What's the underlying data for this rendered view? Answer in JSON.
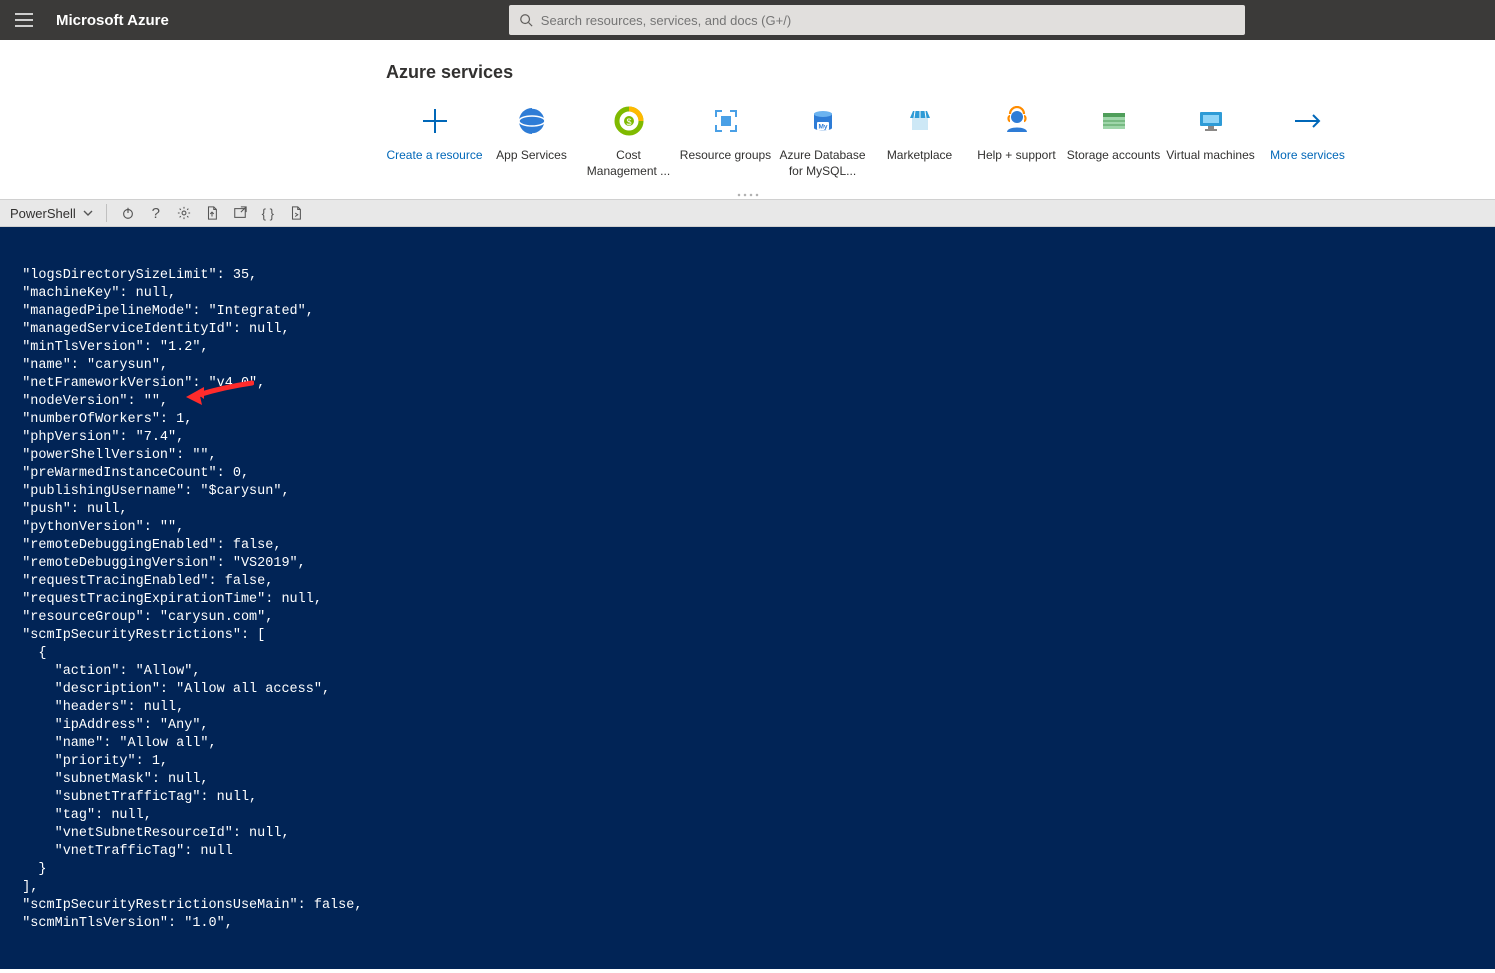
{
  "header": {
    "brand": "Microsoft Azure",
    "search_placeholder": "Search resources, services, and docs (G+/)"
  },
  "services": {
    "title": "Azure services",
    "items": [
      {
        "label": "Create a resource",
        "link": true,
        "icon": "plus"
      },
      {
        "label": "App Services",
        "link": false,
        "icon": "appservices"
      },
      {
        "label": "Cost Management ...",
        "link": false,
        "icon": "cost"
      },
      {
        "label": "Resource groups",
        "link": false,
        "icon": "resourcegroups"
      },
      {
        "label": "Azure Database for MySQL...",
        "link": false,
        "icon": "mysql"
      },
      {
        "label": "Marketplace",
        "link": false,
        "icon": "marketplace"
      },
      {
        "label": "Help + support",
        "link": false,
        "icon": "support"
      },
      {
        "label": "Storage accounts",
        "link": false,
        "icon": "storage"
      },
      {
        "label": "Virtual machines",
        "link": false,
        "icon": "vm"
      },
      {
        "label": "More services",
        "link": true,
        "icon": "arrow"
      }
    ]
  },
  "shell": {
    "mode": "PowerShell"
  },
  "terminal": {
    "json": {
      "logsDirectorySizeLimit": 35,
      "machineKey": null,
      "managedPipelineMode": "Integrated",
      "managedServiceIdentityId": null,
      "minTlsVersion": "1.2",
      "name": "carysun",
      "netFrameworkVersion": "v4.0",
      "nodeVersion": "",
      "numberOfWorkers": 1,
      "phpVersion": "7.4",
      "powerShellVersion": "",
      "preWarmedInstanceCount": 0,
      "publishingUsername": "$carysun",
      "push": null,
      "pythonVersion": "",
      "remoteDebuggingEnabled": false,
      "remoteDebuggingVersion": "VS2019",
      "requestTracingEnabled": false,
      "requestTracingExpirationTime": null,
      "resourceGroup": "carysun.com",
      "scmIpSecurityRestrictions": [
        {
          "action": "Allow",
          "description": "Allow all access",
          "headers": null,
          "ipAddress": "Any",
          "name": "Allow all",
          "priority": 1,
          "subnetMask": null,
          "subnetTrafficTag": null,
          "tag": null,
          "vnetSubnetResourceId": null,
          "vnetTrafficTag": null
        }
      ],
      "scmIpSecurityRestrictionsUseMain": false,
      "scmMinTlsVersion": "1.0"
    },
    "highlight_key": "phpVersion"
  }
}
